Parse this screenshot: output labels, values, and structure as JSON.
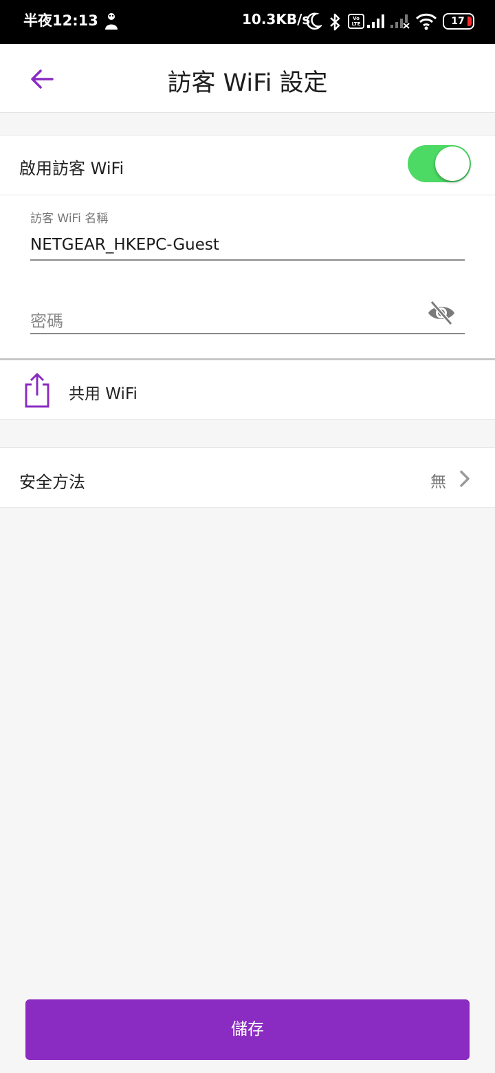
{
  "status_bar": {
    "time": "半夜12:13",
    "network_speed": "10.3KB/s",
    "volte_label": "Vo LTE",
    "battery_level": "17",
    "icons": [
      "person-icon",
      "moon-icon",
      "bluetooth-icon",
      "volte-icon",
      "signal-icon",
      "signal-no-service-icon",
      "wifi-icon",
      "battery-icon"
    ]
  },
  "app_bar": {
    "title": "訪客 WiFi 設定",
    "back_icon": "arrow-left-icon"
  },
  "enable_row": {
    "label": "啟用訪客 WiFi",
    "enabled": true
  },
  "ssid_field": {
    "label": "訪客 WiFi 名稱",
    "value": "NETGEAR_HKEPC-Guest"
  },
  "password_field": {
    "placeholder": "密碼",
    "visibility_icon": "eye-off-icon"
  },
  "share_row": {
    "label": "共用 WiFi",
    "icon": "share-icon"
  },
  "security_row": {
    "label": "安全方法",
    "value": "無",
    "icon": "chevron-right-icon"
  },
  "save_button": {
    "label": "儲存"
  },
  "colors": {
    "accent": "#8a2bc2",
    "toggle_on": "#4cd964",
    "background": "#f6f6f6",
    "status_bar": "#000000"
  }
}
